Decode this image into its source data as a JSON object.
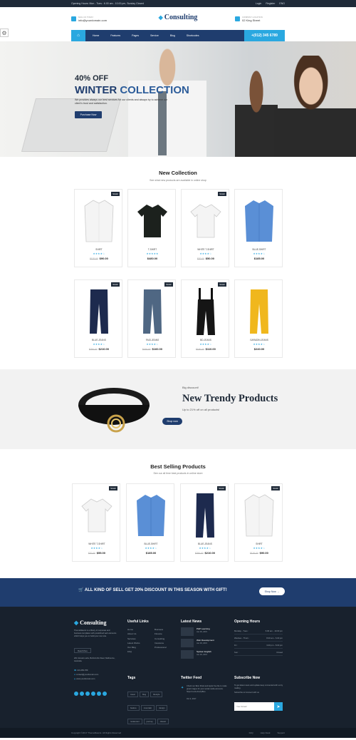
{
  "topbar": {
    "hours": "Opening Hours: Mon - Tues : 6.00 am - 10.00 pm, Sunday Closed",
    "login": "Login",
    "register": "Register",
    "lang": "ENG"
  },
  "header": {
    "mail_label": "MAIL US TODAY",
    "mail_value": "info@yourdomain.com",
    "logo": "Consulting",
    "location_label": "COMPANY LOCATION",
    "location_value": "02 King Street"
  },
  "nav": {
    "items": [
      "Home",
      "Features",
      "Pages",
      "Service",
      "Blog",
      "Shortcodes"
    ],
    "phone": "+(012) 345 6789"
  },
  "hero": {
    "off": "40% OFF",
    "title_a": "WINTER",
    "title_b": "COLLECTION",
    "desc": "We provides always our best services for our clients and always try to achieve our client's trust and satisfaction.",
    "button": "Purchase Now"
  },
  "new_collection": {
    "title": "New Collection",
    "subtitle": "See what new products are available in online shop",
    "products": [
      {
        "name": "SHIRT",
        "old": "$170.00",
        "price": "$90.00",
        "sale": "SALE!",
        "rating": 4
      },
      {
        "name": "T-SHIRT",
        "old": "",
        "price": "$480.00",
        "sale": "",
        "rating": 5
      },
      {
        "name": "WHITE T-SHIRT",
        "old": "$70.00",
        "price": "$50.00",
        "sale": "SALE!",
        "rating": 4
      },
      {
        "name": "BLUE-SHIRT",
        "old": "",
        "price": "$185.00",
        "sale": "",
        "rating": 4
      },
      {
        "name": "BLUE-JEANS",
        "old": "$250.00",
        "price": "$210.00",
        "sale": "SALE!",
        "rating": 4
      },
      {
        "name": "FAID-JEANS",
        "old": "$190.00",
        "price": "$160.00",
        "sale": "SALE!",
        "rating": 4
      },
      {
        "name": "BD-JEANS",
        "old": "$150.00",
        "price": "$110.00",
        "sale": "SALE!",
        "rating": 4
      },
      {
        "name": "GARADIN-JEANS",
        "old": "",
        "price": "$240.00",
        "sale": "",
        "rating": 4
      }
    ]
  },
  "promo": {
    "small": "Big discount!",
    "title": "New Trendy Products",
    "sub": "Up to 21% off on all products!",
    "button": "Shop now"
  },
  "best": {
    "title": "Best Selling Products",
    "subtitle": "See our all time best products in online store",
    "products": [
      {
        "name": "WHITE T-SHIRT",
        "old": "$70.00",
        "price": "$55.00",
        "sale": "SALE!",
        "rating": 4
      },
      {
        "name": "BLUE-SHIRT",
        "old": "",
        "price": "$185.00",
        "sale": "",
        "rating": 4
      },
      {
        "name": "BLUE-JEANS",
        "old": "$250.00",
        "price": "$210.00",
        "sale": "SALE!",
        "rating": 4
      },
      {
        "name": "SHIRT",
        "old": "$120.00",
        "price": "$90.00",
        "sale": "SALE!",
        "rating": 4
      }
    ]
  },
  "banner": {
    "text": "ALL KIND OF SELL GET 20% DISCOUNT IN THIS SEASON WITH GIFT!",
    "button": "Shop Now"
  },
  "footer": {
    "logo": "Consulting",
    "about": "ThemeMascot is a library of corporate and business templates with predefined web elements which helps you to build your own site.",
    "read_more": "Read More",
    "address": "203, Envato Labs, Behind Alis Steel, Melbourne, Australia.",
    "phone": "123-456-789",
    "email": "contact@yourdomain.com",
    "web": "www.yourdomain.com",
    "useful_title": "Useful Links",
    "useful_col1": [
      "Home",
      "About Us",
      "Services",
      "Latest Works",
      "Our Blog",
      "FAQ"
    ],
    "useful_col2": [
      "Business",
      "Finance",
      "Consulting",
      "Insurance",
      "Professional"
    ],
    "news_title": "Latest News",
    "news": [
      {
        "title": "PHP Learning",
        "date": "Jan 06, 2015"
      },
      {
        "title": "Web Development",
        "date": "Jan 06, 2015"
      },
      {
        "title": "Spoken English",
        "date": "Jan 06, 2015"
      }
    ],
    "hours_title": "Opening Hours",
    "hours": [
      {
        "day": "Monday - Tues :",
        "time": "6.00 am - 10.00 pm"
      },
      {
        "day": "Wednes - Thurs :",
        "time": "8.00 am - 6.00 pm"
      },
      {
        "day": "Fri :",
        "time": "3.00 pm - 8.00 pm"
      },
      {
        "day": "Sun :",
        "time": "Closed"
      }
    ],
    "tags_title": "Tags",
    "tags": [
      "travel",
      "blog",
      "lifestyle",
      "feature",
      "mountain",
      "design",
      "restaurant",
      "journey",
      "classic",
      "sunset"
    ],
    "twitter_title": "Twitter Feed",
    "tweet": "Check out 'Elon Musk and Apple' live ble to make great images for your social media accounts. https://t.co/LxhwYp8Hu",
    "tweet_date": "Oct 2, 2017",
    "subscribe_title": "Subscribe Now",
    "subscribe_text": "To get latest news and update keep connected with us by mailing",
    "subscribe_link": "Subscribe to Connect with us",
    "email_placeholder": "Your Email"
  },
  "bottom": {
    "copyright": "Copyright ©2017 ThemeMascot. All Rights Reserved",
    "links": [
      "FAQ",
      "Help Desk",
      "Support"
    ]
  },
  "colors": {
    "navy": "#1f3d6e",
    "accent": "#2aa8e0",
    "footer": "#18212d"
  }
}
